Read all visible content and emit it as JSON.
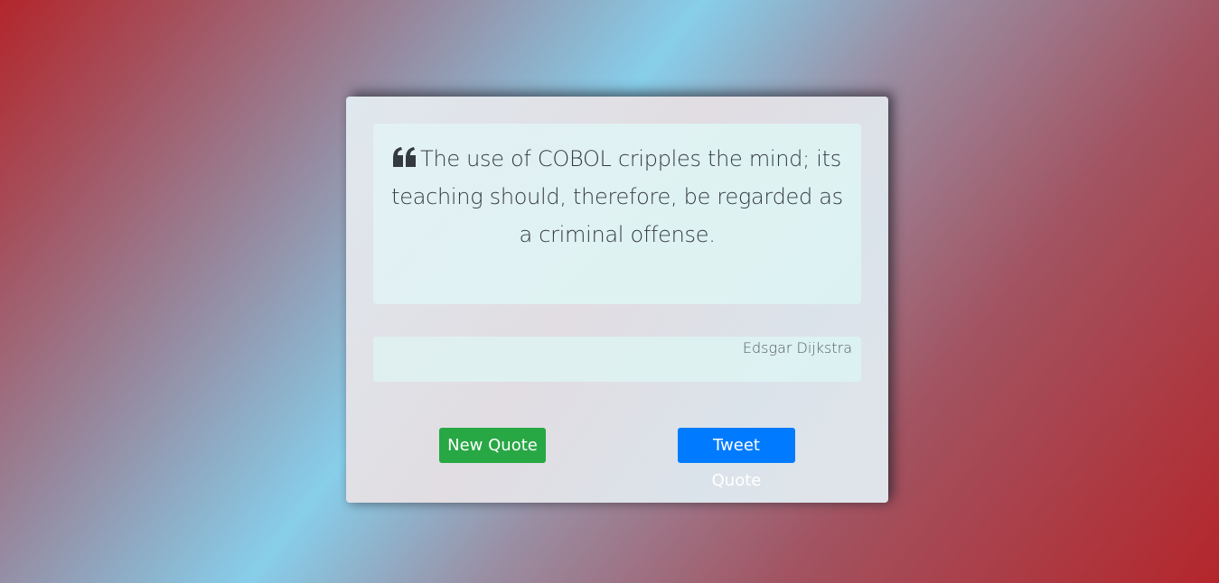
{
  "quote": {
    "icon": "quote-left-icon",
    "text": "The use of COBOL cripples the mind; its teaching should, therefore, be regarded as a criminal offense.",
    "author": "Edsgar Dijkstra"
  },
  "actions": {
    "new_quote_label": "New Quote",
    "tweet_quote_label": "Tweet Quote"
  },
  "colors": {
    "new_quote_button": "#28a745",
    "tweet_quote_button": "#007bff",
    "quote_text": "#343a40",
    "background_red": "#b3262b",
    "background_blue": "#87ceea"
  }
}
